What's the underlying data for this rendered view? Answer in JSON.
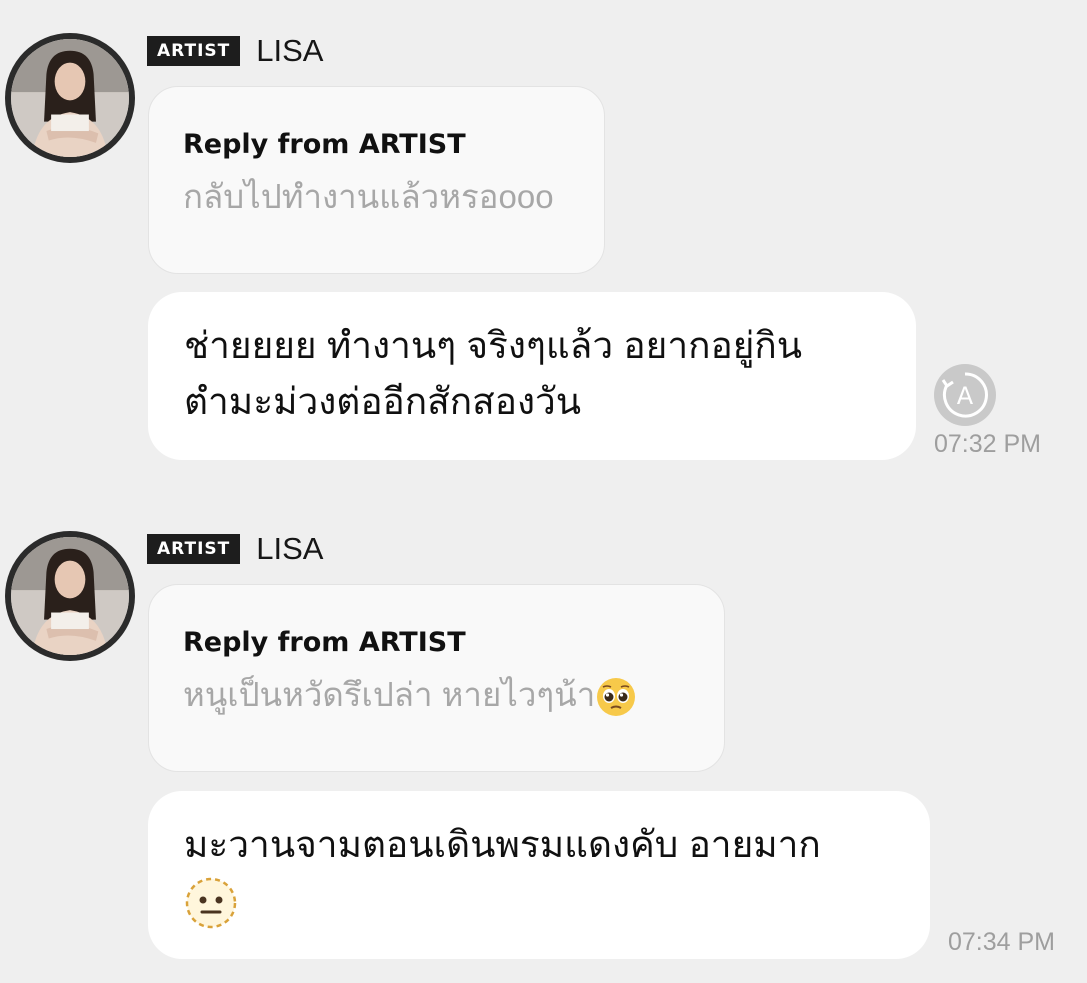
{
  "messages": [
    {
      "badge": "ARTIST",
      "sender": "LISA",
      "reply_title": "Reply from ARTIST",
      "reply_text": "กลับไปทำงานแล้วหรอooo",
      "reply_emoji": "",
      "body_lines": [
        "ช่ายยยย ทำงานๆ จริงๆแล้ว อยากอยู่กิน",
        "ตำมะม่วงต่ออีกสักสองวัน"
      ],
      "body_emoji": "",
      "time": "07:32 PM",
      "translate_icon": "translate-icon"
    },
    {
      "badge": "ARTIST",
      "sender": "LISA",
      "reply_title": "Reply from ARTIST",
      "reply_text": "หนูเป็นหวัดรึเปล่า หายไวๆน้า",
      "reply_emoji": "pleading-face-emoji",
      "body_lines": [
        "มะวานจามตอนเดินพรมแดงคับ อายมาก"
      ],
      "body_emoji": "neutral-face-dashed-emoji",
      "time": "07:34 PM"
    }
  ],
  "colors": {
    "background": "#efefef",
    "badge_bg": "#1d1d1d",
    "reply_card_bg": "#f9f9f9",
    "bubble_bg": "#ffffff",
    "muted_text": "#a7a7a7",
    "timestamp": "#9e9e9e"
  }
}
